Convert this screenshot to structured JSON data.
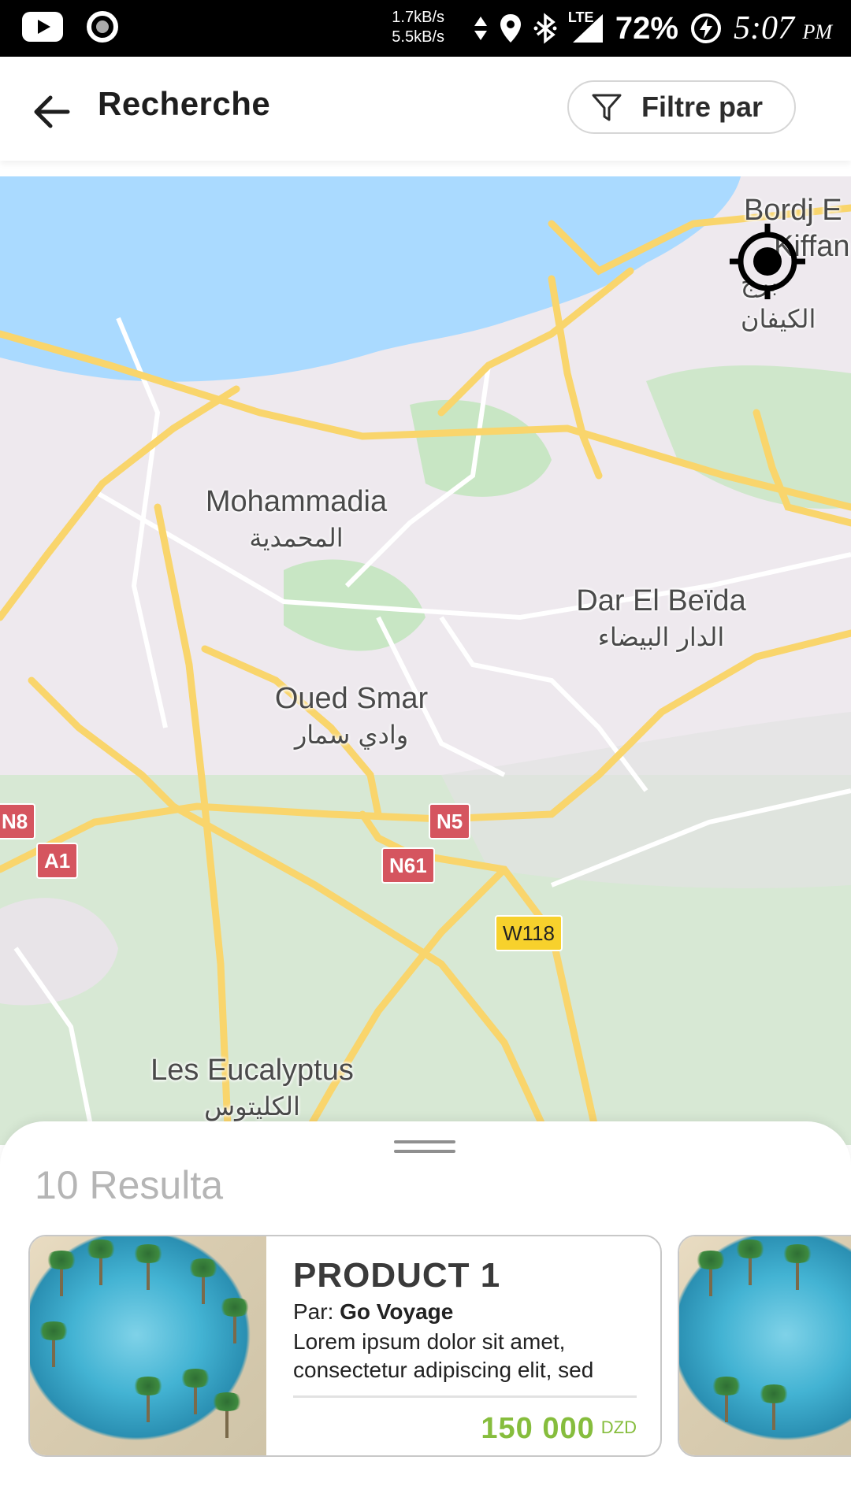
{
  "status_bar": {
    "net_down": "1.7kB/s",
    "net_up": "5.5kB/s",
    "network": "LTE",
    "battery": "72%",
    "time": "5:07",
    "meridiem": "PM",
    "icons": [
      "youtube-icon",
      "record-icon",
      "data-arrows-icon",
      "location-icon",
      "bluetooth-icon",
      "signal-icon",
      "battery-saver-icon"
    ]
  },
  "app_bar": {
    "title": "Recherche",
    "filter_label": "Filtre par",
    "back_icon": "arrow-left-icon",
    "filter_icon": "funnel-icon"
  },
  "map": {
    "places": [
      {
        "name": "Bordj El Kiffan",
        "name_line1": "Bordj E",
        "name_line2": "Kiffan",
        "arabic": "برج الكيفان"
      },
      {
        "name": "Mohammadia",
        "arabic": "المحمدية"
      },
      {
        "name": "Dar El Beïda",
        "arabic": "الدار البيضاء"
      },
      {
        "name": "Oued Smar",
        "arabic": "وادي سمار"
      },
      {
        "name": "Les Eucalyptus",
        "arabic": "الكليتوس"
      }
    ],
    "road_shields": [
      "N8",
      "A1",
      "N5",
      "N61",
      "W118"
    ],
    "locate_icon": "crosshair-icon",
    "colors": {
      "water": "#aadaff",
      "land": "#eee9ee",
      "park": "#c8e6c4",
      "highway": "#f9d56c",
      "road": "#ffffff"
    }
  },
  "results": {
    "count_label": "10 Resulta",
    "cards": [
      {
        "title": "PRODUCT 1",
        "by_label": "Par:",
        "vendor": "Go Voyage",
        "description": "Lorem ipsum dolor sit amet, consectetur adipiscing elit, sed",
        "price": "150 000",
        "currency": "DZD",
        "image": "tropical-beach-photo"
      }
    ]
  }
}
